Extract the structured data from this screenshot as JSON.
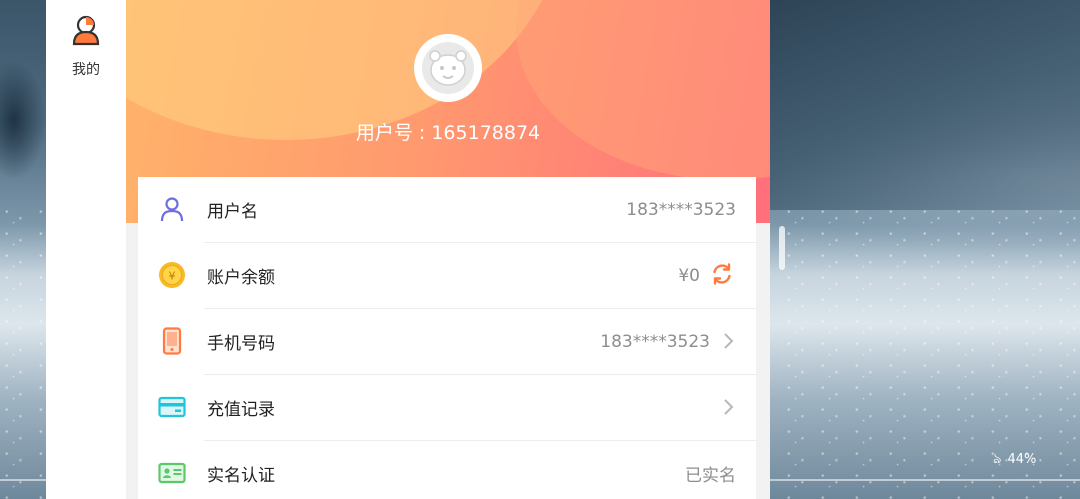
{
  "nav": {
    "items": [
      {
        "label": "我的",
        "icon": "user-profile-icon"
      }
    ]
  },
  "profile": {
    "avatar_icon": "tiger-avatar-icon",
    "user_id_text": "用户号 : 165178874"
  },
  "rows": [
    {
      "label": "用户名",
      "value": "183****3523",
      "icon": "person-outline-icon"
    },
    {
      "label": "账户余额",
      "value": "¥0",
      "icon": "yuan-coin-icon",
      "action_icon": "refresh-icon"
    },
    {
      "label": "手机号码",
      "value": "183****3523",
      "icon": "mobile-phone-icon",
      "action_icon": "chevron-right-icon"
    },
    {
      "label": "充值记录",
      "value": "",
      "icon": "credit-card-icon",
      "action_icon": "chevron-right-icon"
    },
    {
      "label": "实名认证",
      "value": "已实名",
      "icon": "id-card-icon"
    }
  ],
  "status": {
    "battery": "44%"
  },
  "colors": {
    "header_start": "#ffb36a",
    "header_end": "#ff6f7c",
    "accent_orange": "#ff7a3c",
    "icon_purple": "#6f6ee0",
    "icon_cyan": "#21c4d8",
    "icon_green": "#5bc96a",
    "coin_gold": "#f7b924"
  }
}
